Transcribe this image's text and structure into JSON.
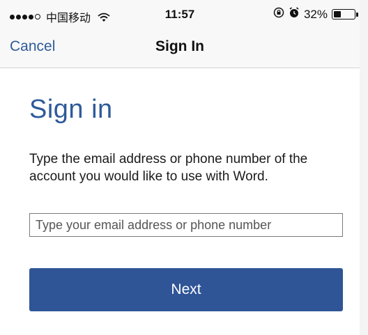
{
  "status_bar": {
    "carrier": "中国移动",
    "signal_bars_filled": 4,
    "signal_bars_total": 5,
    "time": "11:57",
    "battery_percent_label": "32%",
    "battery_level": 0.32,
    "icons": [
      "signal-icon",
      "wifi-icon",
      "rotation-lock-icon",
      "alarm-icon",
      "battery-icon"
    ]
  },
  "nav": {
    "cancel_label": "Cancel",
    "title": "Sign In"
  },
  "main": {
    "heading": "Sign in",
    "instructions": "Type the email address or phone number of the account you would like to use with Word.",
    "email_input": {
      "value": "",
      "placeholder": "Type your email address or phone number"
    },
    "next_label": "Next"
  },
  "colors": {
    "accent": "#2e5a9a",
    "button": "#2f5597",
    "button_text": "#ffffff",
    "nav_background": "#f8f8f8"
  }
}
